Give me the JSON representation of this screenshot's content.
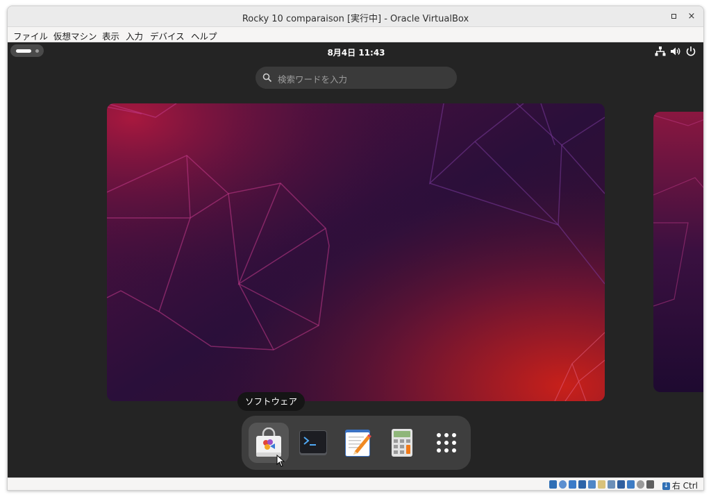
{
  "window": {
    "title": "Rocky 10 comparaison [実行中] - Oracle VirtualBox",
    "maximize_icon": "maximize-icon",
    "close_label": "×"
  },
  "menubar": {
    "items": [
      "ファイル",
      "仮想マシン",
      "表示",
      "入力",
      "デバイス",
      "ヘルプ"
    ]
  },
  "gnome": {
    "clock": "8月4日  11:43",
    "search_placeholder": "検索ワードを入力",
    "tray_icons": [
      "network-icon",
      "volume-icon",
      "power-icon"
    ],
    "tooltip": "ソフトウェア",
    "dash": [
      {
        "name": "software-icon",
        "active": true
      },
      {
        "name": "terminal-icon",
        "active": false
      },
      {
        "name": "text-editor-icon",
        "active": false
      },
      {
        "name": "calculator-icon",
        "active": false
      },
      {
        "name": "app-grid-icon",
        "active": false
      }
    ]
  },
  "statusbar": {
    "host_key": "右 Ctrl",
    "icons": [
      "hard-disk-icon",
      "optical-drive-icon",
      "audio-icon",
      "network-adapter-icon",
      "usb-icon",
      "shared-folder-icon",
      "display-icon",
      "recording-icon",
      "capture-icon",
      "mouse-integration-icon",
      "keyboard-icon"
    ]
  },
  "colors": {
    "desktop_bg": "#242424",
    "wallpaper_purple": "#2d0f3d",
    "wallpaper_red": "#c8201a",
    "dash_bg": "#3e3e3e"
  }
}
